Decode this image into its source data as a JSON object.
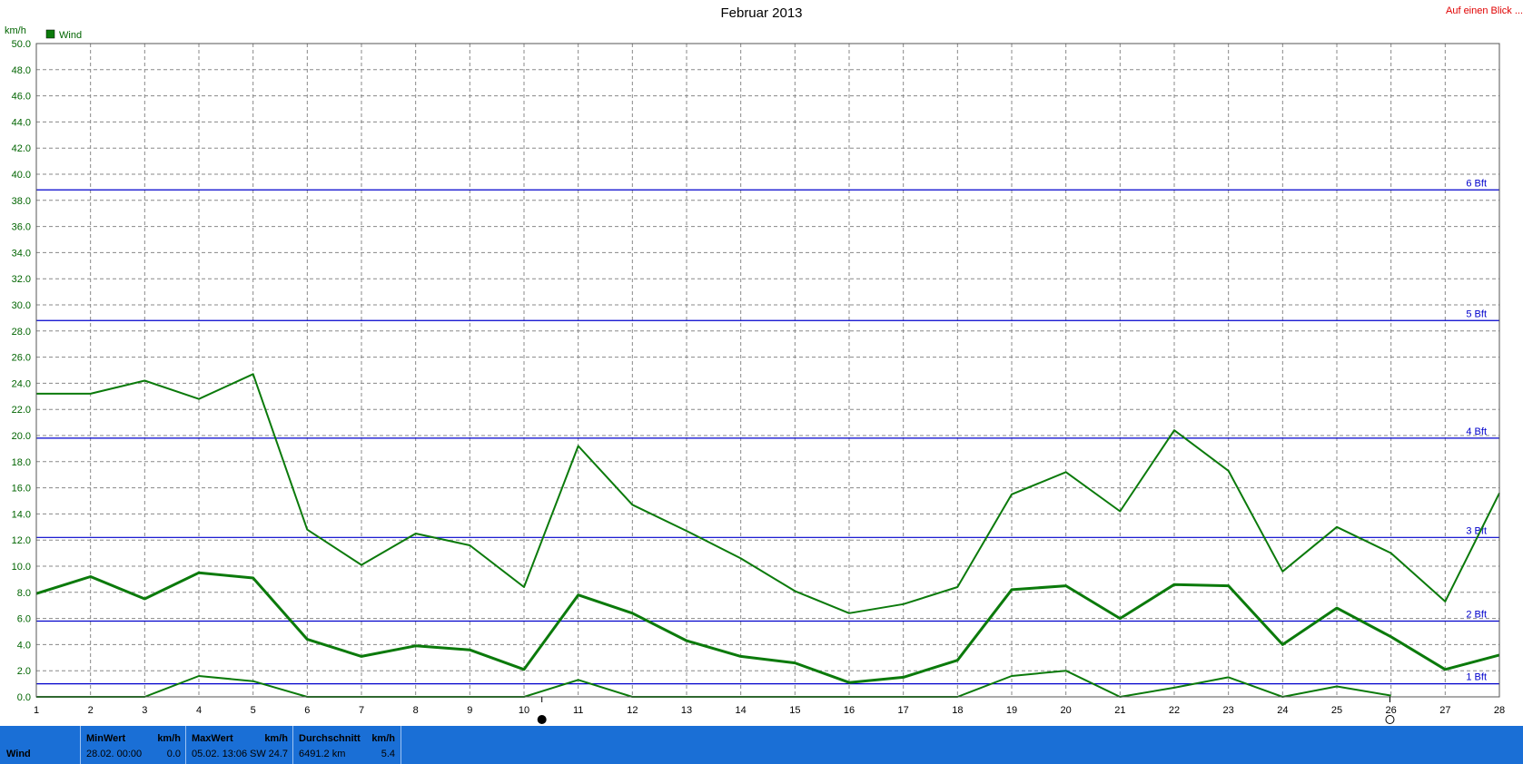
{
  "title": "Februar 2013",
  "top_link": "Auf einen Blick ...",
  "chart_data": {
    "type": "line",
    "ylabel": "km/h",
    "ylim": [
      0,
      50
    ],
    "yticks": [
      "0.0",
      "2.0",
      "4.0",
      "6.0",
      "8.0",
      "10.0",
      "12.0",
      "14.0",
      "16.0",
      "18.0",
      "20.0",
      "22.0",
      "24.0",
      "26.0",
      "28.0",
      "30.0",
      "32.0",
      "34.0",
      "36.0",
      "38.0",
      "40.0",
      "42.0",
      "44.0",
      "46.0",
      "48.0",
      "50.0"
    ],
    "categories": [
      "1",
      "2",
      "3",
      "4",
      "5",
      "6",
      "7",
      "8",
      "9",
      "10",
      "11",
      "12",
      "13",
      "14",
      "15",
      "16",
      "17",
      "18",
      "19",
      "20",
      "21",
      "22",
      "23",
      "24",
      "25",
      "26",
      "27",
      "28"
    ],
    "legend": [
      "Wind"
    ],
    "grid": true,
    "series": [
      {
        "name": "Wind",
        "role": "max",
        "values": [
          23.2,
          23.2,
          24.2,
          22.8,
          24.7,
          12.8,
          10.1,
          12.5,
          11.6,
          8.4,
          19.2,
          14.7,
          12.7,
          10.6,
          8.1,
          6.4,
          7.1,
          8.4,
          15.5,
          17.2,
          14.2,
          20.4,
          17.3,
          9.6,
          13.0,
          11.0,
          7.3,
          15.6
        ]
      },
      {
        "role": "avg",
        "values": [
          7.9,
          9.2,
          7.5,
          9.5,
          9.1,
          4.4,
          3.1,
          3.9,
          3.6,
          2.1,
          7.8,
          6.4,
          4.3,
          3.1,
          2.6,
          1.1,
          1.5,
          2.8,
          8.2,
          8.5,
          6.0,
          8.6,
          8.5,
          4.0,
          6.8,
          4.6,
          2.1,
          3.2
        ]
      },
      {
        "role": "min",
        "values": [
          0.0,
          0.0,
          0.0,
          1.6,
          1.2,
          0.0,
          0.0,
          0.0,
          0.0,
          0.0,
          1.3,
          0.0,
          0.0,
          0.0,
          0.0,
          0.0,
          0.0,
          0.0,
          1.6,
          2.0,
          0.0,
          0.7,
          1.5,
          0.0,
          0.8,
          0.1,
          null,
          null
        ]
      }
    ],
    "reference_lines": [
      {
        "label": "1 Bft",
        "value": 1.0
      },
      {
        "label": "2 Bft",
        "value": 5.8
      },
      {
        "label": "3 Bft",
        "value": 12.2
      },
      {
        "label": "4 Bft",
        "value": 19.8
      },
      {
        "label": "5 Bft",
        "value": 28.8
      },
      {
        "label": "6 Bft",
        "value": 38.8
      }
    ],
    "moon_markers": [
      {
        "day": 10.33,
        "phase": "new"
      },
      {
        "day": 25.98,
        "phase": "full"
      }
    ]
  },
  "colors": {
    "series": "#0b7a0b",
    "axis_text": "#006400",
    "reference": "#0000cc",
    "grid": "#888888",
    "statusbar": "#1a6fd6",
    "link": "#e00000"
  },
  "status_bar": {
    "row_label": "Wind",
    "min": {
      "header": "MinWert",
      "unit": "km/h",
      "datetime": "28.02. 00:00",
      "value": "0.0"
    },
    "max": {
      "header": "MaxWert",
      "unit": "km/h",
      "datetime": "05.02. 13:06",
      "direction": "SW",
      "value": "24.7"
    },
    "avg": {
      "header": "Durchschnitt",
      "unit": "km/h",
      "distance": "6491.2 km",
      "value": "5.4"
    }
  }
}
